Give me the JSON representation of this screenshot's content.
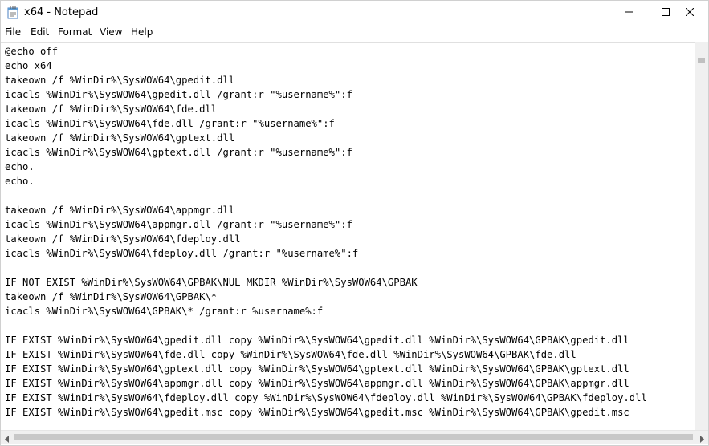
{
  "window": {
    "title": "x64 - Notepad",
    "icon": "notepad-icon"
  },
  "controls": {
    "minimize_icon": "minimize-icon",
    "maximize_icon": "maximize-icon",
    "close_icon": "close-icon"
  },
  "menu": {
    "items": [
      "File",
      "Edit",
      "Format",
      "View",
      "Help"
    ]
  },
  "document": {
    "lines": [
      "@echo off",
      "echo x64",
      "takeown /f %WinDir%\\SysWOW64\\gpedit.dll",
      "icacls %WinDir%\\SysWOW64\\gpedit.dll /grant:r \"%username%\":f",
      "takeown /f %WinDir%\\SysWOW64\\fde.dll",
      "icacls %WinDir%\\SysWOW64\\fde.dll /grant:r \"%username%\":f",
      "takeown /f %WinDir%\\SysWOW64\\gptext.dll",
      "icacls %WinDir%\\SysWOW64\\gptext.dll /grant:r \"%username%\":f",
      "echo.",
      "echo.",
      "",
      "takeown /f %WinDir%\\SysWOW64\\appmgr.dll",
      "icacls %WinDir%\\SysWOW64\\appmgr.dll /grant:r \"%username%\":f",
      "takeown /f %WinDir%\\SysWOW64\\fdeploy.dll",
      "icacls %WinDir%\\SysWOW64\\fdeploy.dll /grant:r \"%username%\":f",
      "",
      "IF NOT EXIST %WinDir%\\SysWOW64\\GPBAK\\NUL MKDIR %WinDir%\\SysWOW64\\GPBAK",
      "takeown /f %WinDir%\\SysWOW64\\GPBAK\\*",
      "icacls %WinDir%\\SysWOW64\\GPBAK\\* /grant:r %username%:f",
      "",
      "IF EXIST %WinDir%\\SysWOW64\\gpedit.dll copy %WinDir%\\SysWOW64\\gpedit.dll %WinDir%\\SysWOW64\\GPBAK\\gpedit.dll",
      "IF EXIST %WinDir%\\SysWOW64\\fde.dll copy %WinDir%\\SysWOW64\\fde.dll %WinDir%\\SysWOW64\\GPBAK\\fde.dll",
      "IF EXIST %WinDir%\\SysWOW64\\gptext.dll copy %WinDir%\\SysWOW64\\gptext.dll %WinDir%\\SysWOW64\\GPBAK\\gptext.dll",
      "IF EXIST %WinDir%\\SysWOW64\\appmgr.dll copy %WinDir%\\SysWOW64\\appmgr.dll %WinDir%\\SysWOW64\\GPBAK\\appmgr.dll",
      "IF EXIST %WinDir%\\SysWOW64\\fdeploy.dll copy %WinDir%\\SysWOW64\\fdeploy.dll %WinDir%\\SysWOW64\\GPBAK\\fdeploy.dll",
      "IF EXIST %WinDir%\\SysWOW64\\gpedit.msc copy %WinDir%\\SysWOW64\\gpedit.msc %WinDir%\\SysWOW64\\GPBAK\\gpedit.msc"
    ]
  },
  "scrollbars": {
    "left_arrow_icon": "scroll-left-icon",
    "right_arrow_icon": "scroll-right-icon"
  }
}
